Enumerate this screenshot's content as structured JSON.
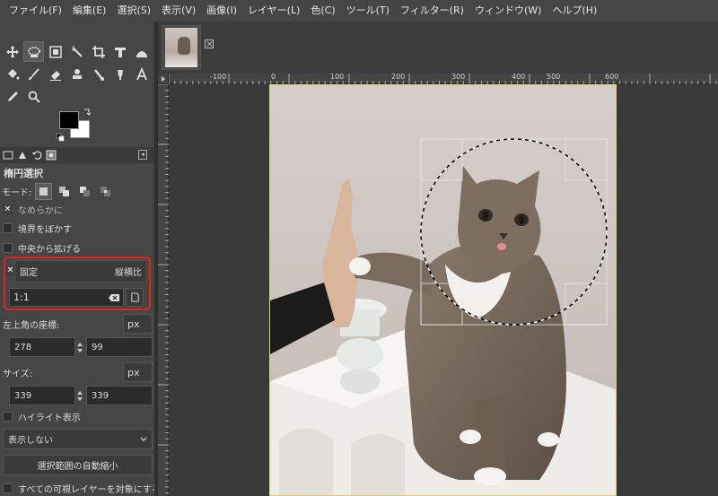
{
  "menu": [
    "ファイル(F)",
    "編集(E)",
    "選択(S)",
    "表示(V)",
    "画像(I)",
    "レイヤー(L)",
    "色(C)",
    "ツール(T)",
    "フィルター(R)",
    "ウィンドウ(W)",
    "ヘルプ(H)"
  ],
  "tool_options": {
    "title": "楕円選択",
    "mode_label": "モード:",
    "antialias_label": "なめらかに",
    "feather_label": "境界をぼかす",
    "expand_center_label": "中央から拡げる",
    "fixed_label": "固定",
    "fixed_value": "縦横比",
    "ratio_value": "1:1",
    "position_label": "左上角の座標:",
    "position_unit": "px",
    "position_x": "278",
    "position_y": "99",
    "size_label": "サイズ:",
    "size_unit": "px",
    "size_w": "339",
    "size_h": "339",
    "highlight_label": "ハイライト表示",
    "guides_value": "表示しない",
    "auto_shrink_label": "選択範囲の自動縮小",
    "all_layers_label": "すべての可視レイヤーを対象にする"
  },
  "ruler": {
    "h_labels": [
      "-100",
      "0",
      "100",
      "200",
      "300",
      "400",
      "500",
      "600"
    ],
    "v_labels": [
      "100",
      "200",
      "300",
      "400",
      "500"
    ]
  }
}
